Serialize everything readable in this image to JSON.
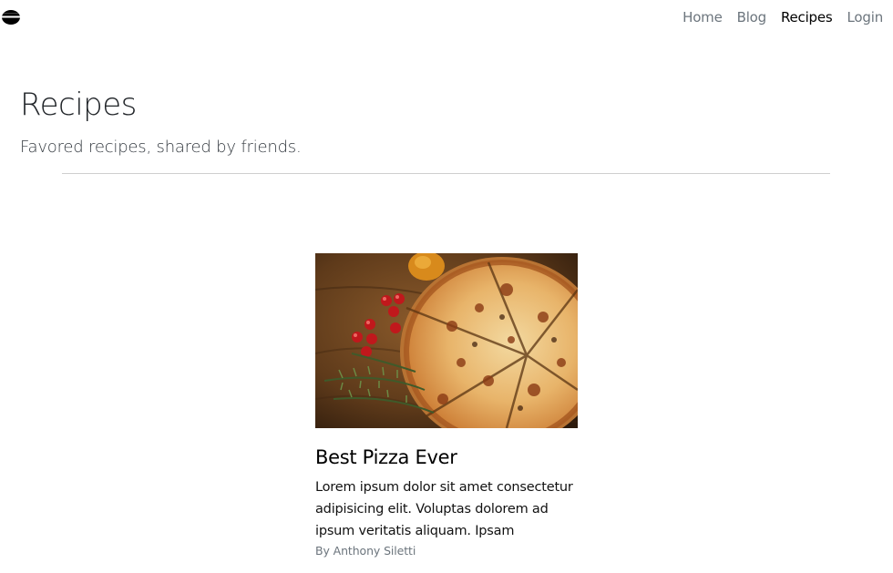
{
  "nav": {
    "brand_icon": "bowl-icon",
    "links": [
      {
        "label": "Home",
        "active": false
      },
      {
        "label": "Blog",
        "active": false
      },
      {
        "label": "Recipes",
        "active": true
      },
      {
        "label": "Login",
        "active": false
      }
    ]
  },
  "header": {
    "title": "Recipes",
    "subtitle": "Favored recipes, shared by friends."
  },
  "recipes": [
    {
      "title": "Best Pizza Ever",
      "excerpt": "Lorem ipsum dolor sit amet consectetur adipisicing elit. Voluptas dolorem ad ipsum veritatis aliquam. Ipsam aperiam...",
      "author": "By Anthony Siletti",
      "image": "pizza-photo"
    }
  ],
  "colors": {
    "text": "#212529",
    "muted": "#6c757d",
    "active": "#000000",
    "divider": "#cfcfcf"
  }
}
